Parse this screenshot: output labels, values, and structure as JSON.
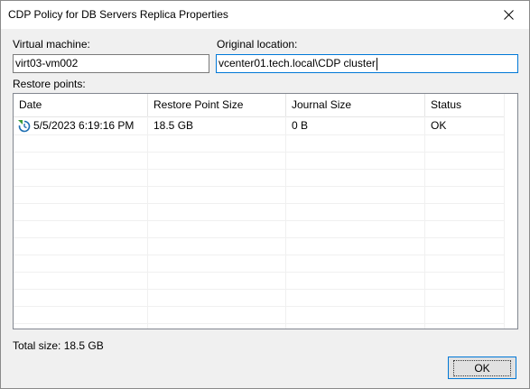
{
  "window": {
    "title": "CDP Policy for DB Servers Replica Properties"
  },
  "vm": {
    "label": "Virtual machine:",
    "value": "virt03-vm002"
  },
  "location": {
    "label": "Original location:",
    "value": "vcenter01.tech.local\\CDP cluster"
  },
  "restore_points": {
    "label": "Restore points:",
    "columns": [
      "Date",
      "Restore Point Size",
      "Journal Size",
      "Status"
    ],
    "rows": [
      {
        "date": "5/5/2023 6:19:16 PM",
        "size": "18.5 GB",
        "journal": "0 B",
        "status": "OK",
        "icon": "restore-point-clock-icon"
      }
    ]
  },
  "total": "Total size: 18.5 GB",
  "buttons": {
    "ok": "OK"
  },
  "colors": {
    "accent": "#0078d7",
    "icon_green": "#3a9a3a",
    "icon_blue": "#1f6fb2"
  }
}
